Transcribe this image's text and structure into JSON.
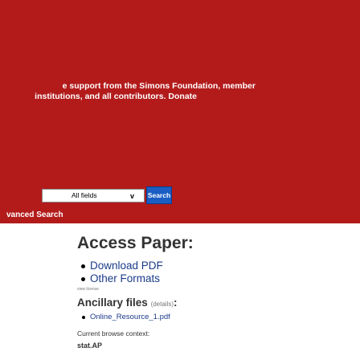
{
  "header": {
    "support_line1": "e support from the Simons Foundation, member",
    "support_line2": "institutions, and all contributors. Donate",
    "accent_color": "#b31b1b"
  },
  "search": {
    "field_select_value": "All fields",
    "field_select_arrow": "v",
    "button_label": "Search",
    "advanced_link": "vanced Search"
  },
  "main": {
    "title": "Access Paper:",
    "downloads": [
      {
        "label": "Download PDF"
      },
      {
        "label": "Other Formats"
      }
    ],
    "view_license": "view license",
    "ancillary_title": "Ancillary files",
    "ancillary_details": "(details)",
    "ancillary_colon": ":",
    "ancillary_files": [
      {
        "label": "Online_Resource_1.pdf"
      }
    ],
    "browse_label": "Current browse context:",
    "browse_value": "stat.AP"
  }
}
